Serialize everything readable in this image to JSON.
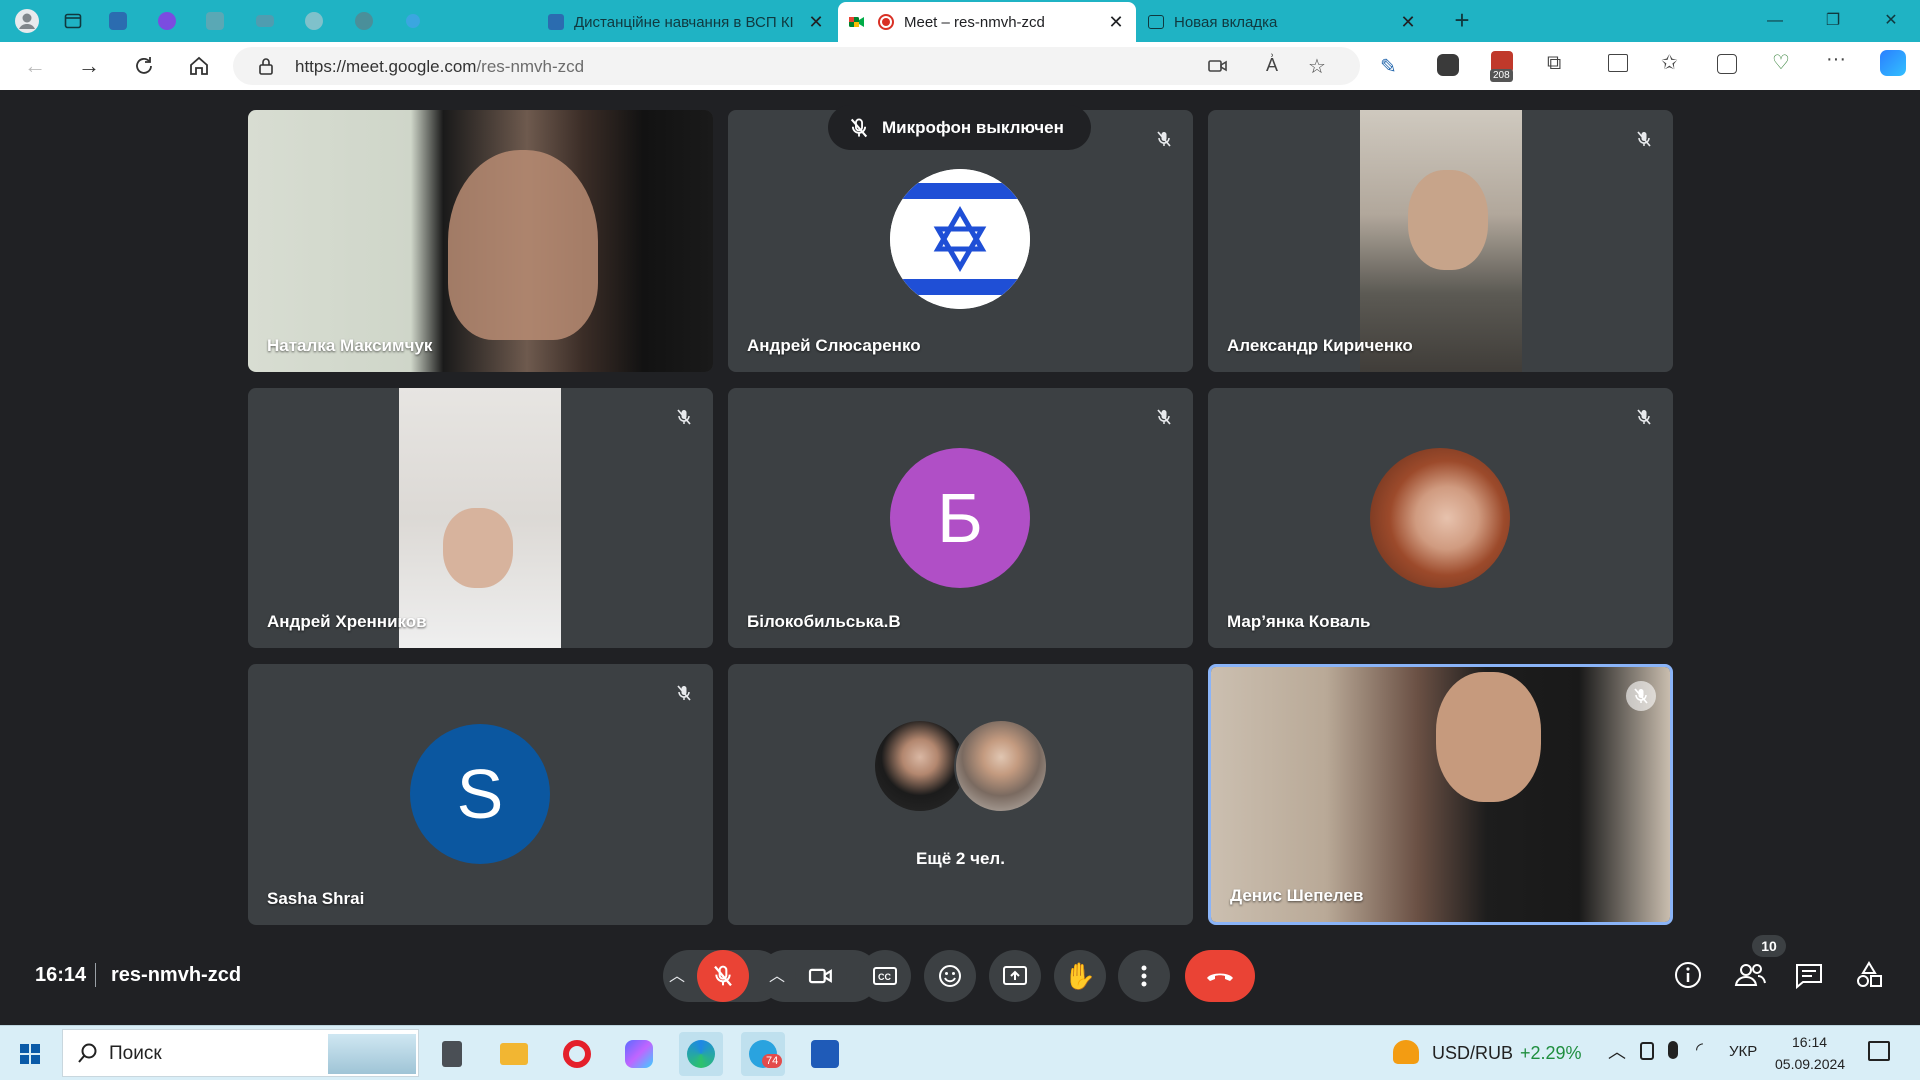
{
  "browser": {
    "tabs": [
      {
        "title": "Дистанційне навчання в ВСП КІ",
        "active": false
      },
      {
        "title": "Meet – res-nmvh-zcd",
        "active": true
      },
      {
        "title": "Новая вкладка",
        "active": false
      }
    ],
    "new_tab_symbol": "+",
    "url_host": "https://meet.google.com",
    "url_path": "/res-nmvh-zcd",
    "extension_badge": "208"
  },
  "meet": {
    "toast": "Микрофон выключен",
    "participants": [
      {
        "name": "Наталка Максимчук",
        "type": "video"
      },
      {
        "name": "Андрей Слюсаренко",
        "type": "avatar-flag"
      },
      {
        "name": "Александр Кириченко",
        "type": "video"
      },
      {
        "name": "Андрей Хренников",
        "type": "video"
      },
      {
        "name": "Білокобильська.В",
        "type": "avatar",
        "letter": "Б",
        "color": "#b04fc6"
      },
      {
        "name": "Мар’янка Коваль",
        "type": "avatar-photo"
      },
      {
        "name": "Sasha Shrai",
        "type": "avatar",
        "letter": "S",
        "color": "#0b57a0"
      },
      {
        "name": "",
        "type": "more"
      },
      {
        "name": "Денис Шепелев",
        "type": "video"
      }
    ],
    "more_label": "Ещё 2 чел.",
    "time": "16:14",
    "meeting_code": "res-nmvh-zcd",
    "people_count": "10",
    "accent_color": "#8ab4f8",
    "end_call_color": "#ea4335"
  },
  "taskbar": {
    "search_label": "Поиск",
    "ticker": "USD/RUB",
    "ticker_change": "+2.29%",
    "telegram_badge": "74",
    "language": "УКР",
    "clock_time": "16:14",
    "clock_date": "05.09.2024"
  }
}
